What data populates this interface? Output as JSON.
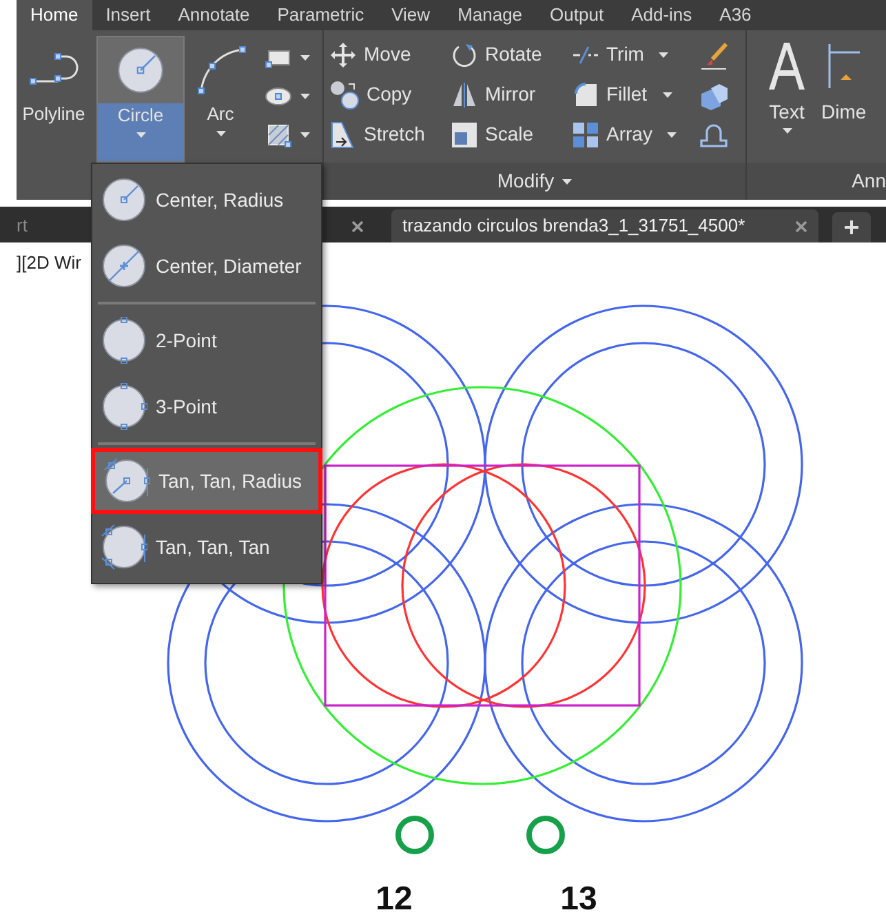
{
  "ribbon_tabs": [
    {
      "label": "Home",
      "selected": true
    },
    {
      "label": "Insert",
      "selected": false
    },
    {
      "label": "Annotate",
      "selected": false
    },
    {
      "label": "Parametric",
      "selected": false
    },
    {
      "label": "View",
      "selected": false
    },
    {
      "label": "Manage",
      "selected": false
    },
    {
      "label": "Output",
      "selected": false
    },
    {
      "label": "Add-ins",
      "selected": false
    },
    {
      "label": "A36",
      "selected": false
    }
  ],
  "draw_panel": {
    "buttons": [
      {
        "label": "Polyline",
        "kind": "polyline",
        "selected": false,
        "dropdown": false
      },
      {
        "label": "Circle",
        "kind": "circle",
        "selected": true,
        "dropdown": true
      },
      {
        "label": "Arc",
        "kind": "arc",
        "selected": false,
        "dropdown": true
      }
    ]
  },
  "modify_panel": {
    "title": "Modify",
    "tools": [
      {
        "label": "Move",
        "kind": "move",
        "dropdown": false
      },
      {
        "label": "Rotate",
        "kind": "rotate",
        "dropdown": false
      },
      {
        "label": "Trim",
        "kind": "trim",
        "dropdown": true
      },
      {
        "label": "Copy",
        "kind": "copy",
        "dropdown": false
      },
      {
        "label": "Mirror",
        "kind": "mirror",
        "dropdown": false
      },
      {
        "label": "Fillet",
        "kind": "fillet",
        "dropdown": true
      },
      {
        "label": "Stretch",
        "kind": "stretch",
        "dropdown": false
      },
      {
        "label": "Scale",
        "kind": "scale",
        "dropdown": false
      },
      {
        "label": "Array",
        "kind": "array",
        "dropdown": true
      }
    ]
  },
  "annotation_panel": {
    "title": "Ann",
    "buttons": [
      {
        "label": "Text"
      },
      {
        "label": "Dime"
      }
    ]
  },
  "file_tabs": [
    {
      "label": "rt",
      "selected": false
    },
    {
      "label": "trazando circulos brenda3_1_31751_4500*",
      "selected": true
    }
  ],
  "circle_menu": {
    "groups": [
      [
        {
          "label": "Center, Radius",
          "kind": "center-radius",
          "selected": false
        },
        {
          "label": "Center, Diameter",
          "kind": "center-diameter",
          "selected": false
        }
      ],
      [
        {
          "label": "2-Point",
          "kind": "two-point",
          "selected": false
        },
        {
          "label": "3-Point",
          "kind": "three-point",
          "selected": false
        }
      ],
      [
        {
          "label": "Tan, Tan, Radius",
          "kind": "tan-tan-radius",
          "selected": true
        },
        {
          "label": "Tan, Tan, Tan",
          "kind": "tan-tan-tan",
          "selected": false
        }
      ]
    ]
  },
  "drawing": {
    "viewport_label": "][2D Wir",
    "markers": [
      {
        "label": "12"
      },
      {
        "label": "13"
      }
    ]
  }
}
